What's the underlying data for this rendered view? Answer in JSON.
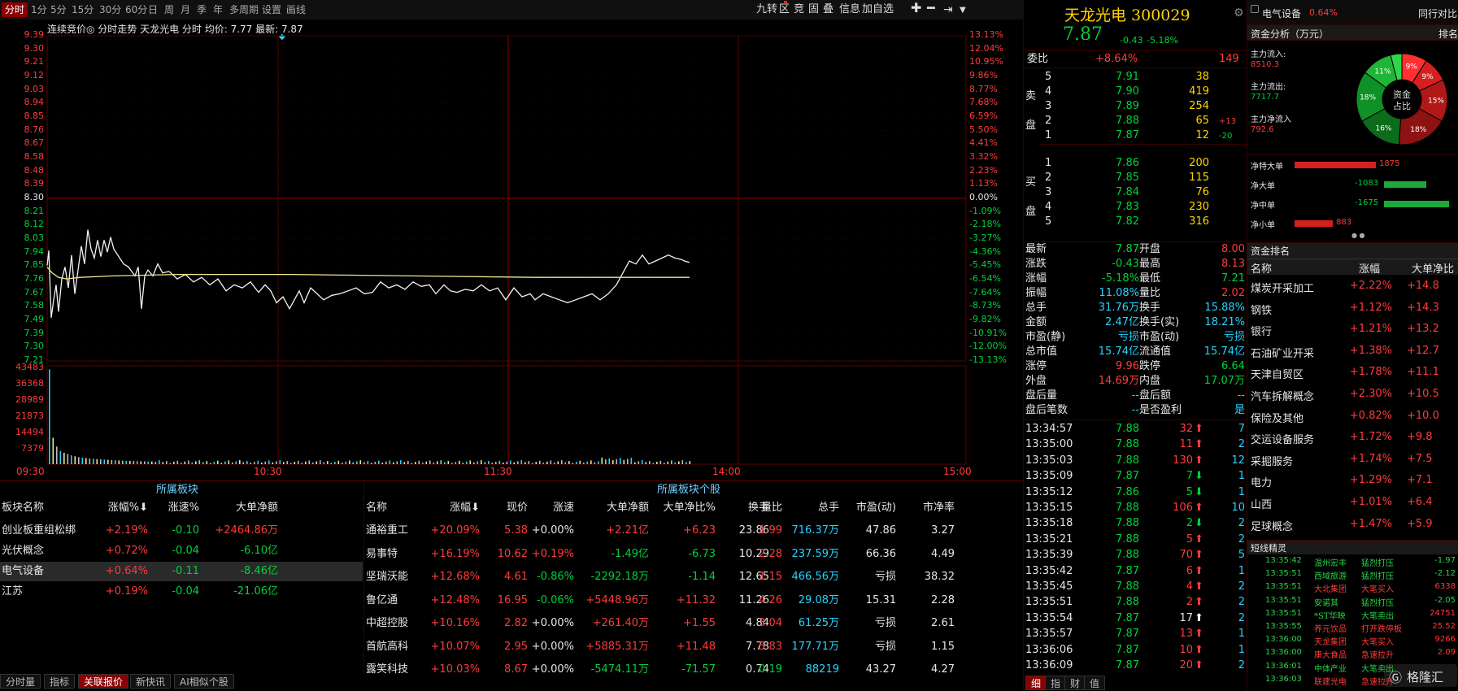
{
  "toolbar": {
    "periods": [
      "分时",
      "1分",
      "5分",
      "15分",
      "30分",
      "60分",
      "日",
      "周",
      "月",
      "季",
      "年",
      "多周期",
      "设置",
      "画线"
    ],
    "right_items": [
      "九转",
      "区",
      "竞",
      "固",
      "叠",
      "信息",
      "加自选"
    ]
  },
  "chart": {
    "info_line": "连续竞价◎  分时走势  天龙光电  分时  均价: 7.77  最新: 7.87",
    "price_ticks": [
      "9.39",
      "9.30",
      "9.21",
      "9.12",
      "9.03",
      "8.94",
      "8.85",
      "8.76",
      "8.67",
      "8.58",
      "8.48",
      "8.39",
      "8.30",
      "8.21",
      "8.12",
      "8.03",
      "7.94",
      "7.85",
      "7.76",
      "7.67",
      "7.58",
      "7.49",
      "7.39",
      "7.30",
      "7.21"
    ],
    "pct_ticks": [
      "13.13%",
      "12.04%",
      "10.95%",
      "9.86%",
      "8.77%",
      "7.68%",
      "6.59%",
      "5.50%",
      "4.41%",
      "3.32%",
      "2.23%",
      "1.13%",
      "0.00%",
      "-1.09%",
      "-2.18%",
      "-3.27%",
      "-4.36%",
      "-5.45%",
      "-6.54%",
      "-7.64%",
      "-8.73%",
      "-9.82%",
      "-10.91%",
      "-12.00%",
      "-13.13%"
    ],
    "vol_ticks": [
      "43483",
      "36368",
      "28989",
      "21873",
      "14494",
      "7379"
    ],
    "time_ticks": [
      "09:30",
      "10:30",
      "11:30",
      "14:00",
      "15:00"
    ]
  },
  "sector_table": {
    "title": "所属板块",
    "headers": [
      "板块名称",
      "涨幅%",
      "涨速%",
      "大单净额"
    ],
    "rows": [
      [
        "创业板重组松绑",
        "+2.19%",
        "-0.10",
        "+2464.86万"
      ],
      [
        "光伏概念",
        "+0.72%",
        "-0.04",
        "-6.10亿"
      ],
      [
        "电气设备",
        "+0.64%",
        "-0.11",
        "-8.46亿"
      ],
      [
        "江苏",
        "+0.19%",
        "-0.04",
        "-21.06亿"
      ]
    ]
  },
  "stock_table": {
    "title": "所属板块个股",
    "headers": [
      "名称",
      "涨幅",
      "现价",
      "涨速",
      "大单净额",
      "大单净比%",
      "换手",
      "量比",
      "总手",
      "市盈(动)",
      "市净率"
    ],
    "rows": [
      [
        "通裕重工",
        "+20.09%",
        "5.38",
        "+0.00%",
        "+2.21亿",
        "+6.23",
        "23.86",
        "1.99",
        "716.37万",
        "47.86",
        "3.27"
      ],
      [
        "易事特",
        "+16.19%",
        "10.62",
        "+0.19%",
        "-1.49亿",
        "-6.73",
        "10.29",
        "2.28",
        "237.59万",
        "66.36",
        "4.49"
      ],
      [
        "坚瑞沃能",
        "+12.68%",
        "4.61",
        "-0.86%",
        "-2292.18万",
        "-1.14",
        "12.65",
        "1.15",
        "466.56万",
        "亏损",
        "38.32"
      ],
      [
        "鲁亿通",
        "+12.48%",
        "16.95",
        "-0.06%",
        "+5448.96万",
        "+11.32",
        "11.26",
        "4.26",
        "29.08万",
        "15.31",
        "2.28"
      ],
      [
        "中超控股",
        "+10.16%",
        "2.82",
        "+0.00%",
        "+261.40万",
        "+1.55",
        "4.84",
        "3.04",
        "61.25万",
        "亏损",
        "2.61"
      ],
      [
        "首航高科",
        "+10.07%",
        "2.95",
        "+0.00%",
        "+5885.31万",
        "+11.48",
        "7.78",
        "5.83",
        "177.71万",
        "亏损",
        "1.15"
      ],
      [
        "露笑科技",
        "+10.03%",
        "8.67",
        "+0.00%",
        "-5474.11万",
        "-71.57",
        "0.74",
        "0.19",
        "88219",
        "43.27",
        "4.27"
      ]
    ]
  },
  "bottom_tabs": [
    "分时量",
    "指标",
    "关联报价",
    "新快讯",
    "AI相似个股"
  ],
  "quote": {
    "name": "天龙光电 300029",
    "price": "7.87",
    "change": "-0.43",
    "change_pct": "-5.18%",
    "weibi_label": "委比",
    "weibi": "+8.64%",
    "weicha": "149",
    "sell": [
      [
        "5",
        "7.91",
        "38",
        ""
      ],
      [
        "4",
        "7.90",
        "419",
        ""
      ],
      [
        "3",
        "7.89",
        "254",
        ""
      ],
      [
        "2",
        "7.88",
        "65",
        "+13"
      ],
      [
        "1",
        "7.87",
        "12",
        "-20"
      ]
    ],
    "buy": [
      [
        "1",
        "7.86",
        "200"
      ],
      [
        "2",
        "7.85",
        "115"
      ],
      [
        "3",
        "7.84",
        "76"
      ],
      [
        "4",
        "7.83",
        "230"
      ],
      [
        "5",
        "7.82",
        "316"
      ]
    ],
    "sell_label": [
      "卖",
      "盘"
    ],
    "buy_label": [
      "买",
      "盘"
    ],
    "stats": [
      [
        "最新",
        "7.87",
        "开盘",
        "8.00"
      ],
      [
        "涨跌",
        "-0.43",
        "最高",
        "8.13"
      ],
      [
        "涨幅",
        "-5.18%",
        "最低",
        "7.21"
      ],
      [
        "振幅",
        "11.08%",
        "量比",
        "2.02"
      ],
      [
        "总手",
        "31.76万",
        "换手",
        "15.88%"
      ],
      [
        "金额",
        "2.47亿",
        "换手(实)",
        "18.21%"
      ],
      [
        "市盈(静)",
        "亏损",
        "市盈(动)",
        "亏损"
      ],
      [
        "总市值",
        "15.74亿",
        "流通值",
        "15.74亿"
      ],
      [
        "涨停",
        "9.96",
        "跌停",
        "6.64"
      ],
      [
        "外盘",
        "14.69万",
        "内盘",
        "17.07万"
      ],
      [
        "盘后量",
        "--",
        "盘后额",
        "--"
      ],
      [
        "盘后笔数",
        "--",
        "是否盈利",
        "是"
      ]
    ],
    "ticks": [
      [
        "13:34:57",
        "7.88",
        "32",
        "up",
        "7"
      ],
      [
        "13:35:00",
        "7.88",
        "11",
        "up",
        "2"
      ],
      [
        "13:35:03",
        "7.88",
        "130",
        "up",
        "12"
      ],
      [
        "13:35:09",
        "7.87",
        "7",
        "down",
        "1"
      ],
      [
        "13:35:12",
        "7.86",
        "5",
        "down",
        "1"
      ],
      [
        "13:35:15",
        "7.88",
        "106",
        "up",
        "10"
      ],
      [
        "13:35:18",
        "7.88",
        "2",
        "down",
        "2"
      ],
      [
        "13:35:21",
        "7.88",
        "5",
        "up",
        "2"
      ],
      [
        "13:35:39",
        "7.88",
        "70",
        "up",
        "5"
      ],
      [
        "13:35:42",
        "7.87",
        "6",
        "up",
        "1"
      ],
      [
        "13:35:45",
        "7.88",
        "4",
        "up",
        "2"
      ],
      [
        "13:35:51",
        "7.88",
        "2",
        "up",
        "2"
      ],
      [
        "13:35:54",
        "7.87",
        "17",
        "up",
        "2"
      ],
      [
        "13:35:57",
        "7.87",
        "13",
        "up",
        "1"
      ],
      [
        "13:36:06",
        "7.87",
        "10",
        "up",
        "1"
      ],
      [
        "13:36:09",
        "7.87",
        "20",
        "up",
        "2"
      ]
    ],
    "bottom_tabs": [
      "细",
      "指",
      "财",
      "值"
    ]
  },
  "fund": {
    "industry": "电气设备",
    "industry_pct": "0.64%",
    "compare": "同行对比",
    "analysis_title": "资金分析（万元）",
    "rank_tab": "排名",
    "inflow_label": "主力流入:",
    "inflow": "8510.3",
    "outflow_label": "主力流出:",
    "outflow": "7717.7",
    "net_label": "主力净流入",
    "net": "792.6",
    "donut_center": [
      "资金",
      "占比"
    ],
    "donut_slices": [
      {
        "label": "9%",
        "color": "#ff3030",
        "value": 9
      },
      {
        "label": "9%",
        "color": "#d62020",
        "value": 9
      },
      {
        "label": "15%",
        "color": "#b01818",
        "value": 15
      },
      {
        "label": "18%",
        "color": "#8e1212",
        "value": 18
      },
      {
        "label": "16%",
        "color": "#0d6b1c",
        "value": 16
      },
      {
        "label": "18%",
        "color": "#109126",
        "value": 18
      },
      {
        "label": "11%",
        "color": "#1fb536",
        "value": 11
      },
      {
        "label": "4%",
        "color": "#2ed64a",
        "value": 4
      }
    ],
    "net_bars": [
      {
        "label": "净特大单",
        "value": 1875
      },
      {
        "label": "净大单",
        "value": -1083
      },
      {
        "label": "净中单",
        "value": -1675
      },
      {
        "label": "净小单",
        "value": 883
      }
    ],
    "rank_title": "资金排名",
    "rank_headers": [
      "名称",
      "涨幅",
      "大单净比"
    ],
    "rank_rows": [
      [
        "煤炭开采加工",
        "+2.22%",
        "+14.8"
      ],
      [
        "钢铁",
        "+1.12%",
        "+14.3"
      ],
      [
        "银行",
        "+1.21%",
        "+13.2"
      ],
      [
        "石油矿业开采",
        "+1.38%",
        "+12.7"
      ],
      [
        "天津自贸区",
        "+1.78%",
        "+11.1"
      ],
      [
        "汽车拆解概念",
        "+2.30%",
        "+10.5"
      ],
      [
        "保险及其他",
        "+0.82%",
        "+10.0"
      ],
      [
        "交运设备服务",
        "+1.72%",
        "+9.8"
      ],
      [
        "采掘服务",
        "+1.74%",
        "+7.5"
      ],
      [
        "电力",
        "+1.29%",
        "+7.1"
      ],
      [
        "山西",
        "+1.01%",
        "+6.4"
      ],
      [
        "足球概念",
        "+1.47%",
        "+5.9"
      ]
    ],
    "sprite_title": "短线精灵",
    "sprite_rows": [
      [
        "13:35:42",
        "温州宏丰",
        "猛烈打压",
        "-1.97"
      ],
      [
        "13:35:51",
        "西域旅游",
        "猛烈打压",
        "-2.12"
      ],
      [
        "13:35:51",
        "大北集团",
        "大笔买入",
        "6338"
      ],
      [
        "13:35:51",
        "安诺其",
        "猛烈打压",
        "-2.05"
      ],
      [
        "13:35:51",
        "*ST华映",
        "大笔卖出",
        "24751"
      ],
      [
        "13:35:55",
        "养元饮品",
        "打开跌停板",
        "25.52"
      ],
      [
        "13:36:00",
        "天龙集团",
        "大笔买入",
        "9266"
      ],
      [
        "13:36:00",
        "康大食品",
        "急速拉升",
        "2.09"
      ],
      [
        "13:36:01",
        "中体产业",
        "大笔卖出",
        ""
      ],
      [
        "13:36:03",
        "联建光电",
        "急速拉升",
        ""
      ]
    ],
    "watermark": "格隆汇"
  }
}
